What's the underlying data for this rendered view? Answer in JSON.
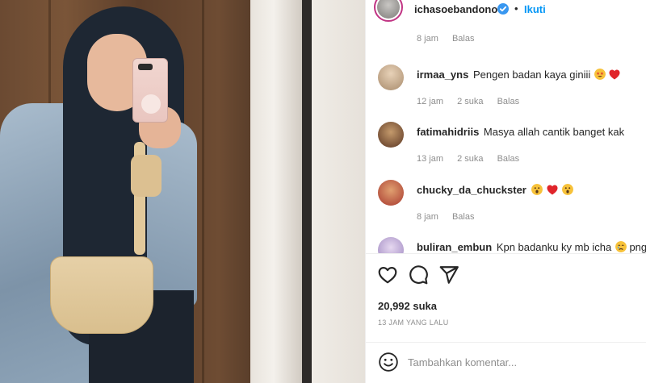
{
  "post": {
    "author": "ichasoebandono",
    "follow_label": "Ikuti",
    "separator": "•"
  },
  "comments": [
    {
      "username": "",
      "text": "",
      "time": "8 jam",
      "likes": "",
      "reply": "Balas",
      "avatar_color": "#d8b7a0"
    },
    {
      "username": "irmaa_yns",
      "text": "Pengen badan kaya giniii",
      "emojis": [
        "star-struck-emoji",
        "red-heart-emoji"
      ],
      "time": "12 jam",
      "likes": "2 suka",
      "reply": "Balas",
      "avatar_color": "#c9b08f"
    },
    {
      "username": "fatimahidriis",
      "text": "Masya allah cantik banget kak",
      "emojis": [],
      "time": "13 jam",
      "likes": "2 suka",
      "reply": "Balas",
      "avatar_color": "#8b5a3c"
    },
    {
      "username": "chucky_da_chuckster",
      "text": "",
      "emojis": [
        "astonished-emoji",
        "red-heart-emoji",
        "astonished-emoji"
      ],
      "time": "8 jam",
      "likes": "",
      "reply": "Balas",
      "avatar_color": "#b8453a"
    },
    {
      "username": "buliran_embun",
      "text": "Kpn badanku ky mb icha",
      "text_tail": " png",
      "emojis": [
        "crying-emoji"
      ],
      "avatar_color": "#c7b9d9"
    }
  ],
  "likes_label": "20,992 suka",
  "timestamp": "13 JAM YANG LALU",
  "add_comment": {
    "placeholder": "Tambahkan komentar..."
  },
  "colors": {
    "accent": "#0095f6",
    "verified": "#3897f0",
    "heart": "#ed4956",
    "muted": "#8e8e8e"
  }
}
